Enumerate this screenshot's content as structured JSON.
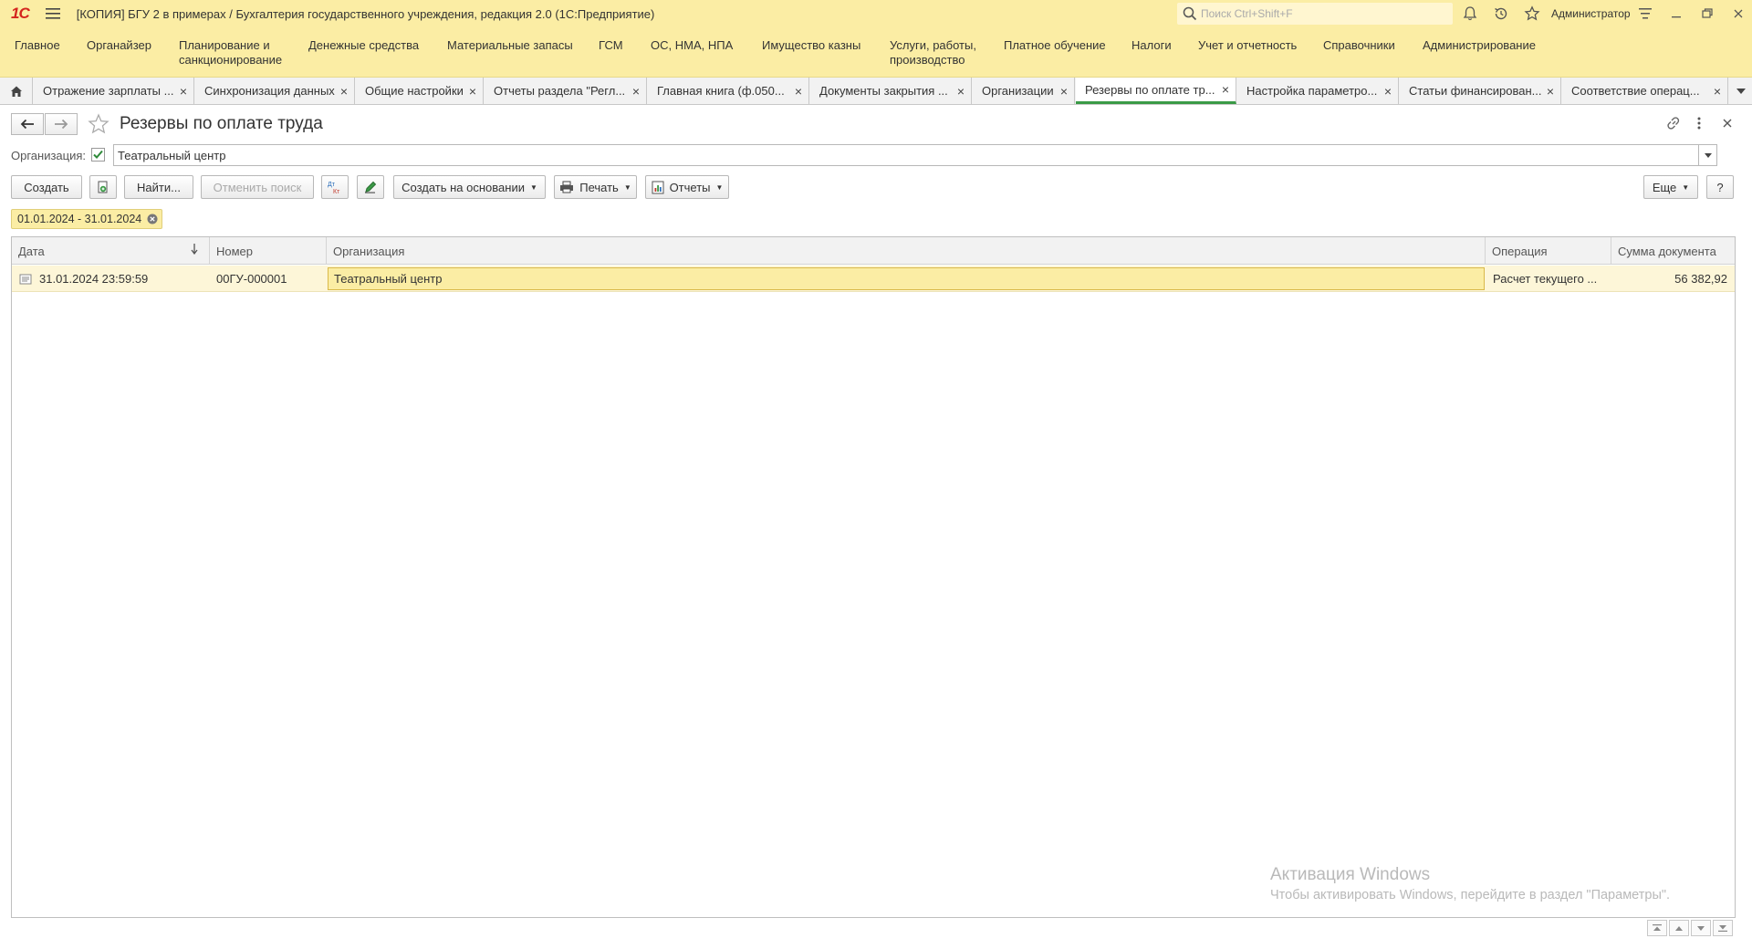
{
  "titlebar": {
    "logo": "1С",
    "title": "[КОПИЯ] БГУ 2  в примерах / Бухгалтерия государственного учреждения, редакция 2.0  (1С:Предприятие)",
    "search_placeholder": "Поиск Ctrl+Shift+F",
    "user": "Администратор"
  },
  "menu": [
    "Главное",
    "Органайзер",
    "Планирование и\nсанкционирование",
    "Денежные средства",
    "Материальные запасы",
    "ГСМ",
    "ОС, НМА, НПА",
    "Имущество казны",
    "Услуги, работы,\nпроизводство",
    "Платное обучение",
    "Налоги",
    "Учет и отчетность",
    "Справочники",
    "Администрирование"
  ],
  "tabs": [
    "Отражение зарплаты ...",
    "Синхронизация данных",
    "Общие настройки",
    "Отчеты раздела \"Регл...",
    "Главная книга (ф.050...",
    "Документы закрытия ...",
    "Организации",
    "Резервы по оплате тр...",
    "Настройка параметро...",
    "Статьи финансирован...",
    "Соответствие операц..."
  ],
  "form": {
    "title": "Резервы по оплате труда",
    "org_label": "Организация:",
    "org_checked": true,
    "org_value": "Театральный центр"
  },
  "toolbar": {
    "create": "Создать",
    "find": "Найти...",
    "cancel_search": "Отменить поиск",
    "create_based": "Создать на основании",
    "print": "Печать",
    "reports": "Отчеты",
    "more": "Еще",
    "help": "?"
  },
  "filter": {
    "period": "01.01.2024 - 31.01.2024"
  },
  "table": {
    "columns": [
      "Дата",
      "Номер",
      "Организация",
      "Операция",
      "Сумма документа"
    ],
    "rows": [
      {
        "date": "31.01.2024 23:59:59",
        "number": "00ГУ-000001",
        "organization": "Театральный центр",
        "operation": "Расчет текущего ...",
        "amount": "56 382,92"
      }
    ]
  },
  "watermark": {
    "line1": "Активация Windows",
    "line2": "Чтобы активировать Windows, перейдите в раздел \"Параметры\"."
  },
  "colors": {
    "accent_yellow": "#fbeda4",
    "active_tab_green": "#3a9a46",
    "logo_red": "#d4251e"
  }
}
